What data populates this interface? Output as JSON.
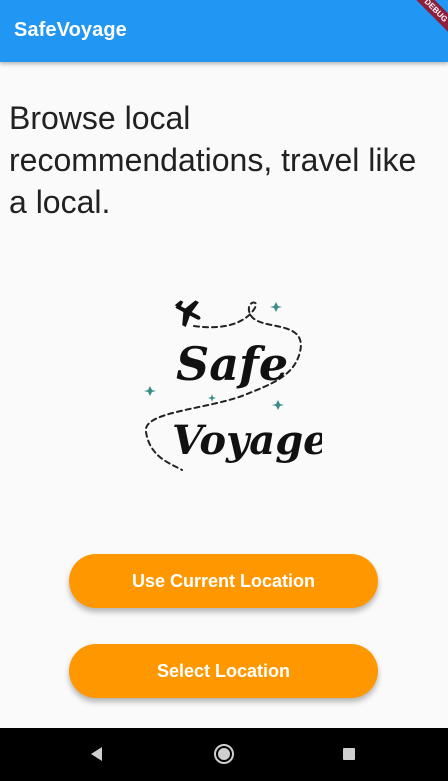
{
  "app": {
    "title": "SafeVoyage",
    "debug_label": "DEBUG",
    "primary_color": "#2196f3",
    "accent_color": "#ff9800"
  },
  "main": {
    "tagline": "Browse local recommendations, travel like a local.",
    "logo": {
      "line1": "Safe",
      "line2": "Voyage",
      "icon": "airplane-icon"
    },
    "buttons": {
      "use_current_location": "Use Current Location",
      "select_location": "Select Location"
    }
  },
  "system_nav": {
    "back_icon": "back-triangle-icon",
    "home_icon": "home-circle-icon",
    "recents_icon": "recents-square-icon"
  }
}
